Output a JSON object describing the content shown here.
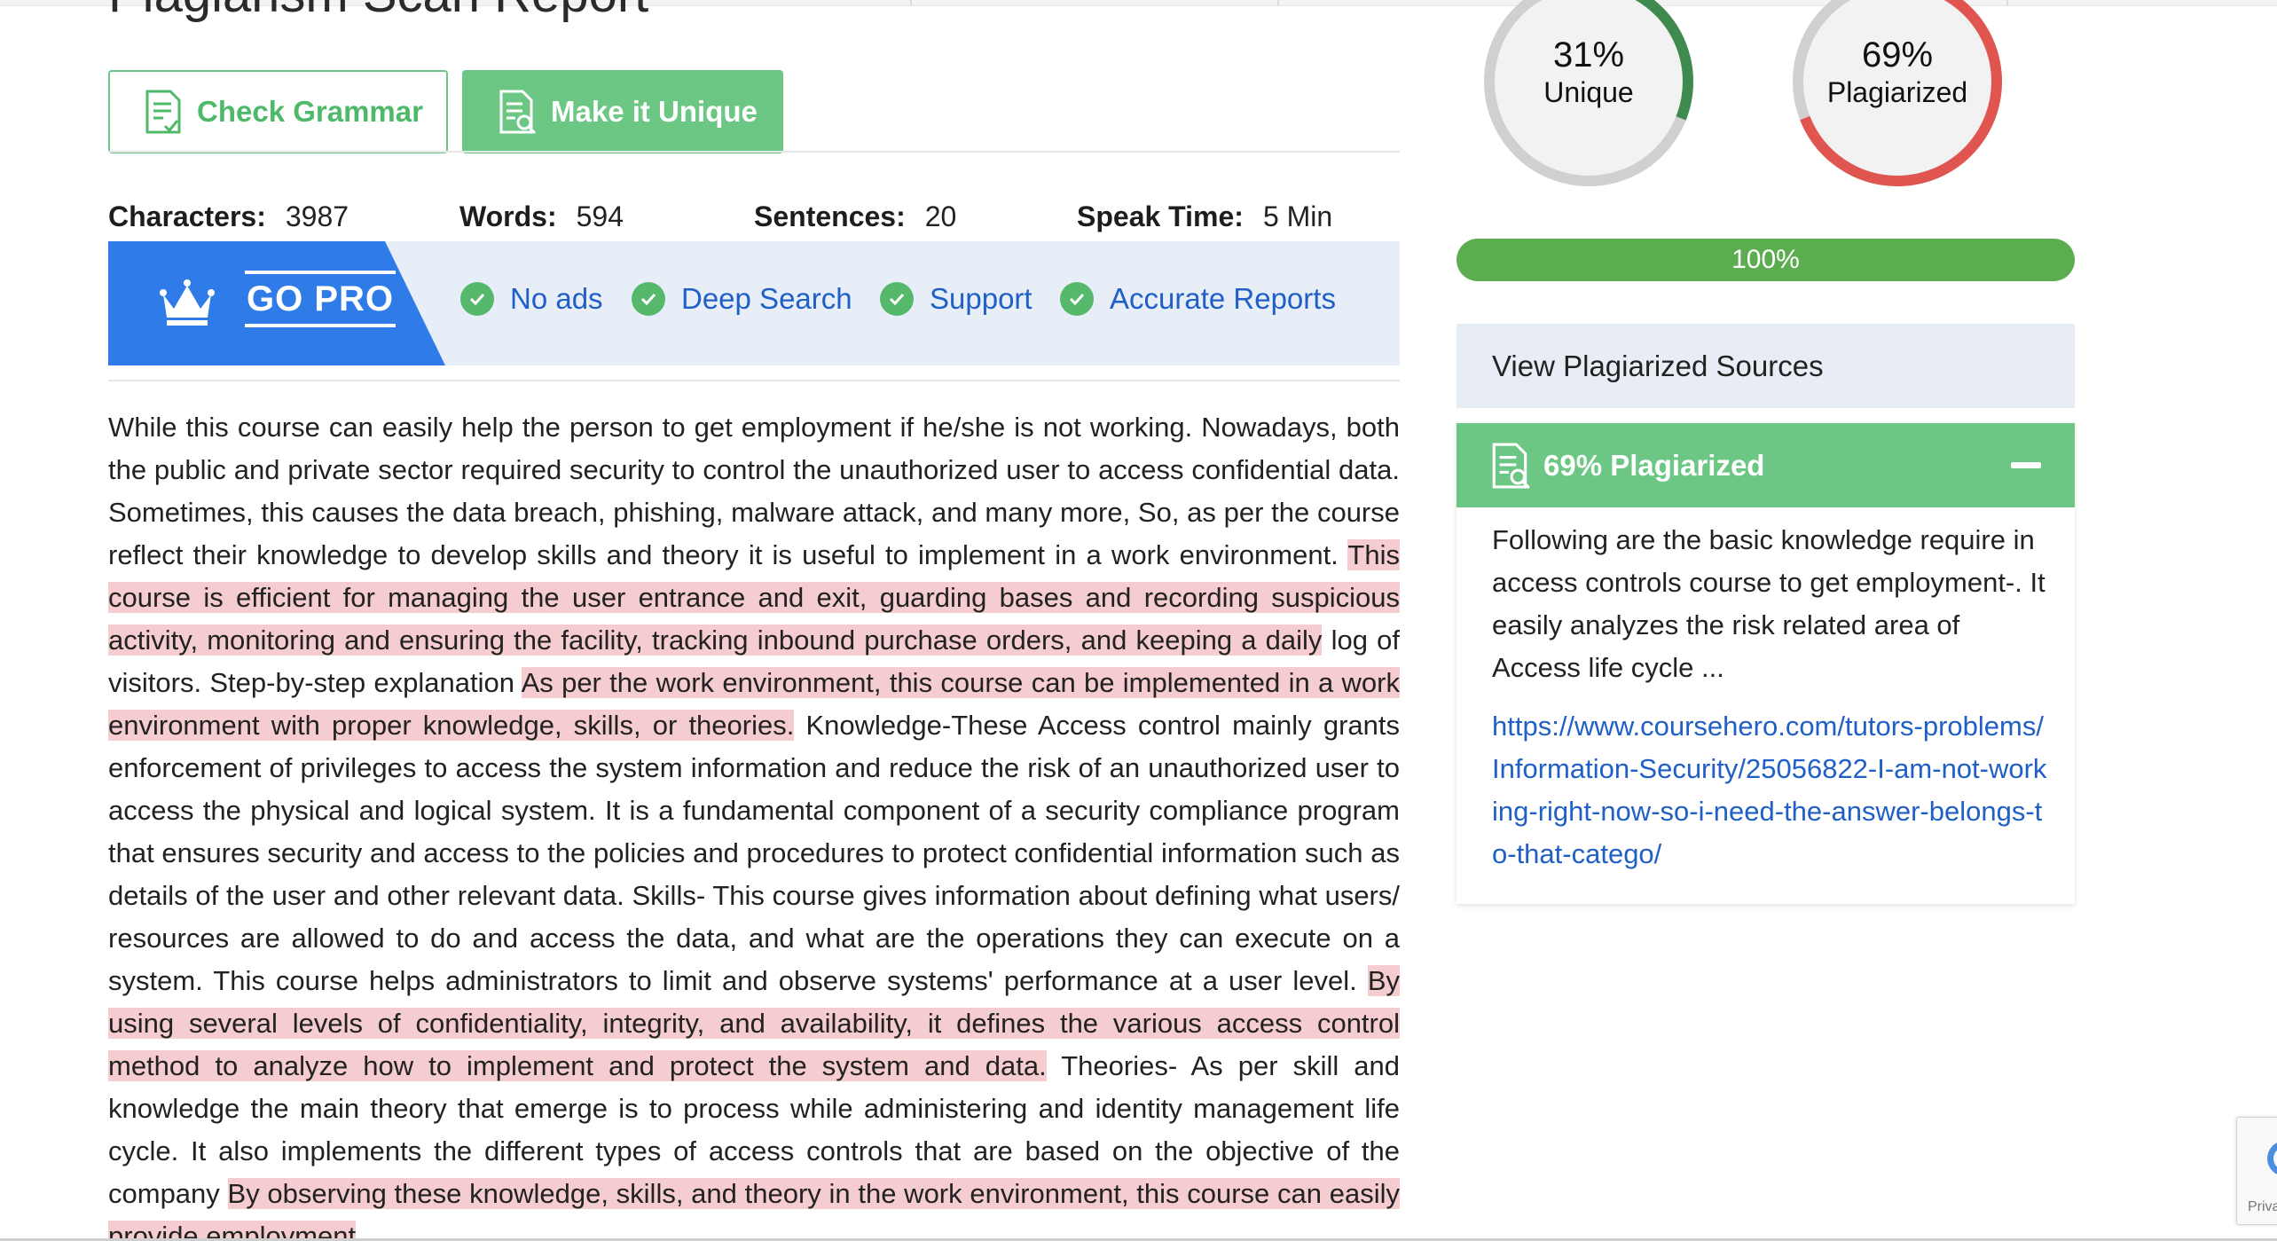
{
  "page": {
    "title": "Plagiarism Scan Report"
  },
  "buttons": {
    "check_grammar": "Check Grammar",
    "make_unique": "Make it Unique"
  },
  "stats": [
    {
      "label": "Characters:",
      "value": "3987"
    },
    {
      "label": "Words:",
      "value": "594"
    },
    {
      "label": "Sentences:",
      "value": "20"
    },
    {
      "label": "Speak Time:",
      "value": "5 Min"
    }
  ],
  "go_pro": {
    "label": "GO PRO",
    "features": [
      "No ads",
      "Deep Search",
      "Support",
      "Accurate Reports"
    ]
  },
  "article": {
    "segments": [
      {
        "text": "While this course can easily help the person to get employment if he/she is not working. Nowadays, both the public and private sector required security to control the unauthorized user to access confidential data. Sometimes, this causes the data breach, phishing, malware attack, and many more, So, as per the course reflect their knowledge to develop skills and theory it is useful to implement in a work environment. ",
        "plagiarized": false
      },
      {
        "text": "This course is efficient for managing the user entrance and exit, guarding bases and recording suspicious activity, monitoring and ensuring the facility, tracking inbound purchase orders, and keeping a daily",
        "plagiarized": true
      },
      {
        "text": " log of visitors. Step-by-step explanation ",
        "plagiarized": false
      },
      {
        "text": "As per the work environment, this course can be implemented in a work environment with proper knowledge, skills, or theories.",
        "plagiarized": true
      },
      {
        "text": " Knowledge-These Access control mainly grants enforcement of privileges to access the system information and reduce the risk of an unauthorized user to access the physical and logical system. It is a fundamental component of a security compliance program that ensures security and access to the policies and procedures to protect confidential information such as details of the user and other relevant data. Skills- This course gives information about defining what users/ resources are allowed to do and access the data, and what are the operations they can execute on a system. This course helps administrators to limit and observe systems' performance at a user level. ",
        "plagiarized": false
      },
      {
        "text": "By using several levels of confidentiality, integrity, and availability, it defines the various access control method to analyze how to implement and protect the system and data.",
        "plagiarized": true
      },
      {
        "text": " Theories- As per skill and knowledge the main theory that emerge is to process while administering and identity management life cycle. It also implements the different types of access controls that are based on the objective of the company ",
        "plagiarized": false
      },
      {
        "text": "By observing these knowledge, skills, and theory in the work environment, this course can easily provide employment",
        "plagiarized": true
      }
    ]
  },
  "results": {
    "unique": {
      "percent": "31%",
      "label": "Unique",
      "fraction": 0.31,
      "color": "#3f8a4f"
    },
    "plagiarized": {
      "percent": "69%",
      "label": "Plagiarized",
      "fraction": 0.69,
      "color": "#e0554f"
    },
    "progress_label": "100%",
    "progress_fraction": 1.0
  },
  "sources": {
    "view_label": "View Plagiarized Sources",
    "card": {
      "title": "69% Plagiarized",
      "excerpt": "Following are the basic knowledge require in access controls course to get employment-. It easily analyzes the risk related area of Access life cycle ...",
      "url": "https://www.coursehero.com/tutors-problems/Information-Security/25056822-I-am-not-working-right-now-so-i-need-the-answer-belongs-to-that-catego/"
    }
  },
  "recaptcha": {
    "text": "Priva"
  },
  "colors": {
    "green": "#6cc784",
    "blue": "#2f7be8",
    "highlight": "#f5cccf",
    "link": "#1f5fc7"
  }
}
